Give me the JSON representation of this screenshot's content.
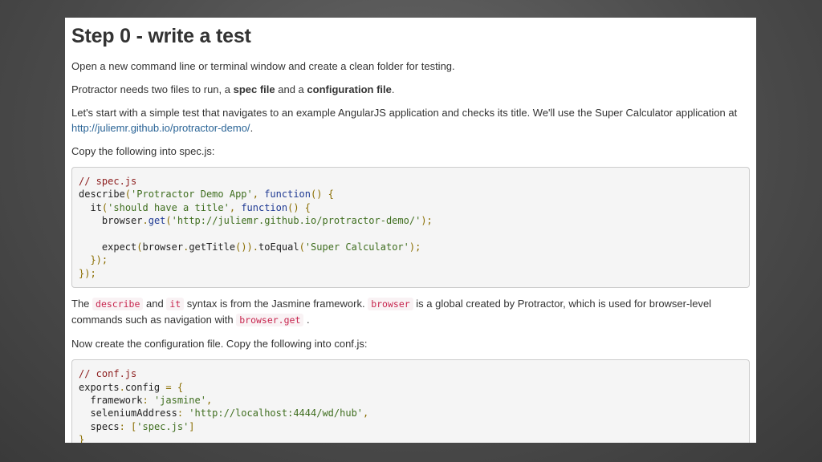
{
  "heading": "Step 0 - write a test",
  "para1": "Open a new command line or terminal window and create a clean folder for testing.",
  "para2": {
    "before": "Protractor needs two files to run, a ",
    "spec_file": "spec file",
    "middle": " and a ",
    "config_file": "configuration file",
    "after": "."
  },
  "para3": {
    "text": "Let's start with a simple test that navigates to an example AngularJS application and checks its title. We'll use the Super Calculator application at ",
    "link": "http://juliemr.github.io/protractor-demo/",
    "after": "."
  },
  "para4": "Copy the following into spec.js:",
  "spec_code": {
    "comment": "// spec.js",
    "describe": "describe",
    "describe_title": "'Protractor Demo App'",
    "function_kw": "function",
    "it": "it",
    "it_title": "'should have a title'",
    "browser": "browser",
    "get": "get",
    "url": "'http://juliemr.github.io/protractor-demo/'",
    "expect": "expect",
    "getTitle": "getTitle",
    "toEqual": "toEqual",
    "expected_title": "'Super Calculator'"
  },
  "para5": {
    "the": "The ",
    "code_describe": "describe",
    "and": " and ",
    "code_it": "it",
    "mid": " syntax is from the Jasmine framework. ",
    "code_browser": "browser",
    "rest": " is a global created by Protractor, which is used for browser-level commands such as navigation with ",
    "code_browser_get": "browser.get",
    "end": " ."
  },
  "para6": "Now create the configuration file. Copy the following into conf.js:",
  "conf_code": {
    "comment": "// conf.js",
    "exports": "exports",
    "config": "config",
    "framework_key": "framework",
    "framework_val": "'jasmine'",
    "selenium_key": "seleniumAddress",
    "selenium_val": "'http://localhost:4444/wd/hub'",
    "specs_key": "specs",
    "specs_val": "'spec.js'"
  },
  "colors": {
    "comment": "#8b1a1a",
    "string": "#3f6e1f",
    "keyword": "#1f3a93",
    "inline_code": "#c7254e",
    "link": "#2a6496"
  }
}
